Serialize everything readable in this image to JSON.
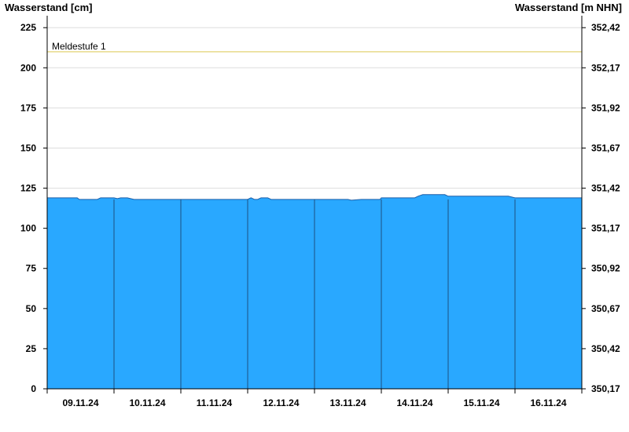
{
  "chart_data": {
    "type": "area",
    "ylabel_left": "Wasserstand [cm]",
    "ylabel_right": "Wasserstand [m NHN]",
    "ylim": [
      0,
      230
    ],
    "yticks_left": [
      "0",
      "25",
      "50",
      "75",
      "100",
      "125",
      "150",
      "175",
      "200",
      "225"
    ],
    "yticks_left_values": [
      0,
      25,
      50,
      75,
      100,
      125,
      150,
      175,
      200,
      225
    ],
    "yticks_right": [
      "350,17",
      "350,42",
      "350,67",
      "350,92",
      "351,17",
      "351,42",
      "351,67",
      "351,92",
      "352,17",
      "352,42"
    ],
    "x_categories": [
      "09.11.24",
      "10.11.24",
      "11.11.24",
      "12.11.24",
      "13.11.24",
      "14.11.24",
      "15.11.24",
      "16.11.24"
    ],
    "threshold": {
      "label": "Meldestufe 1",
      "value": 210,
      "color": "#e8d98a"
    },
    "fill_color": "#29a8ff",
    "grid": true,
    "series": [
      {
        "x_days": [
          0,
          0.45,
          0.48,
          0.75,
          0.8,
          1.0,
          1.05,
          1.1,
          1.2,
          1.3,
          1.35,
          2.0,
          2.5,
          3.0,
          3.05,
          3.1,
          3.15,
          3.2,
          3.3,
          3.35,
          4.0,
          4.5,
          4.55,
          4.7,
          4.98,
          5.0,
          5.5,
          5.55,
          5.62,
          5.65,
          5.95,
          6.0,
          6.5,
          6.9,
          7.0,
          7.5,
          8.0
        ],
        "values": [
          119,
          119,
          118,
          118,
          119,
          119,
          118.5,
          119,
          119,
          118,
          118,
          118,
          118,
          118,
          119,
          118,
          118,
          119,
          119,
          118,
          118,
          118,
          117.5,
          118,
          118,
          119,
          119,
          120,
          121,
          121,
          121,
          120,
          120,
          120,
          119,
          119,
          119
        ]
      }
    ]
  }
}
